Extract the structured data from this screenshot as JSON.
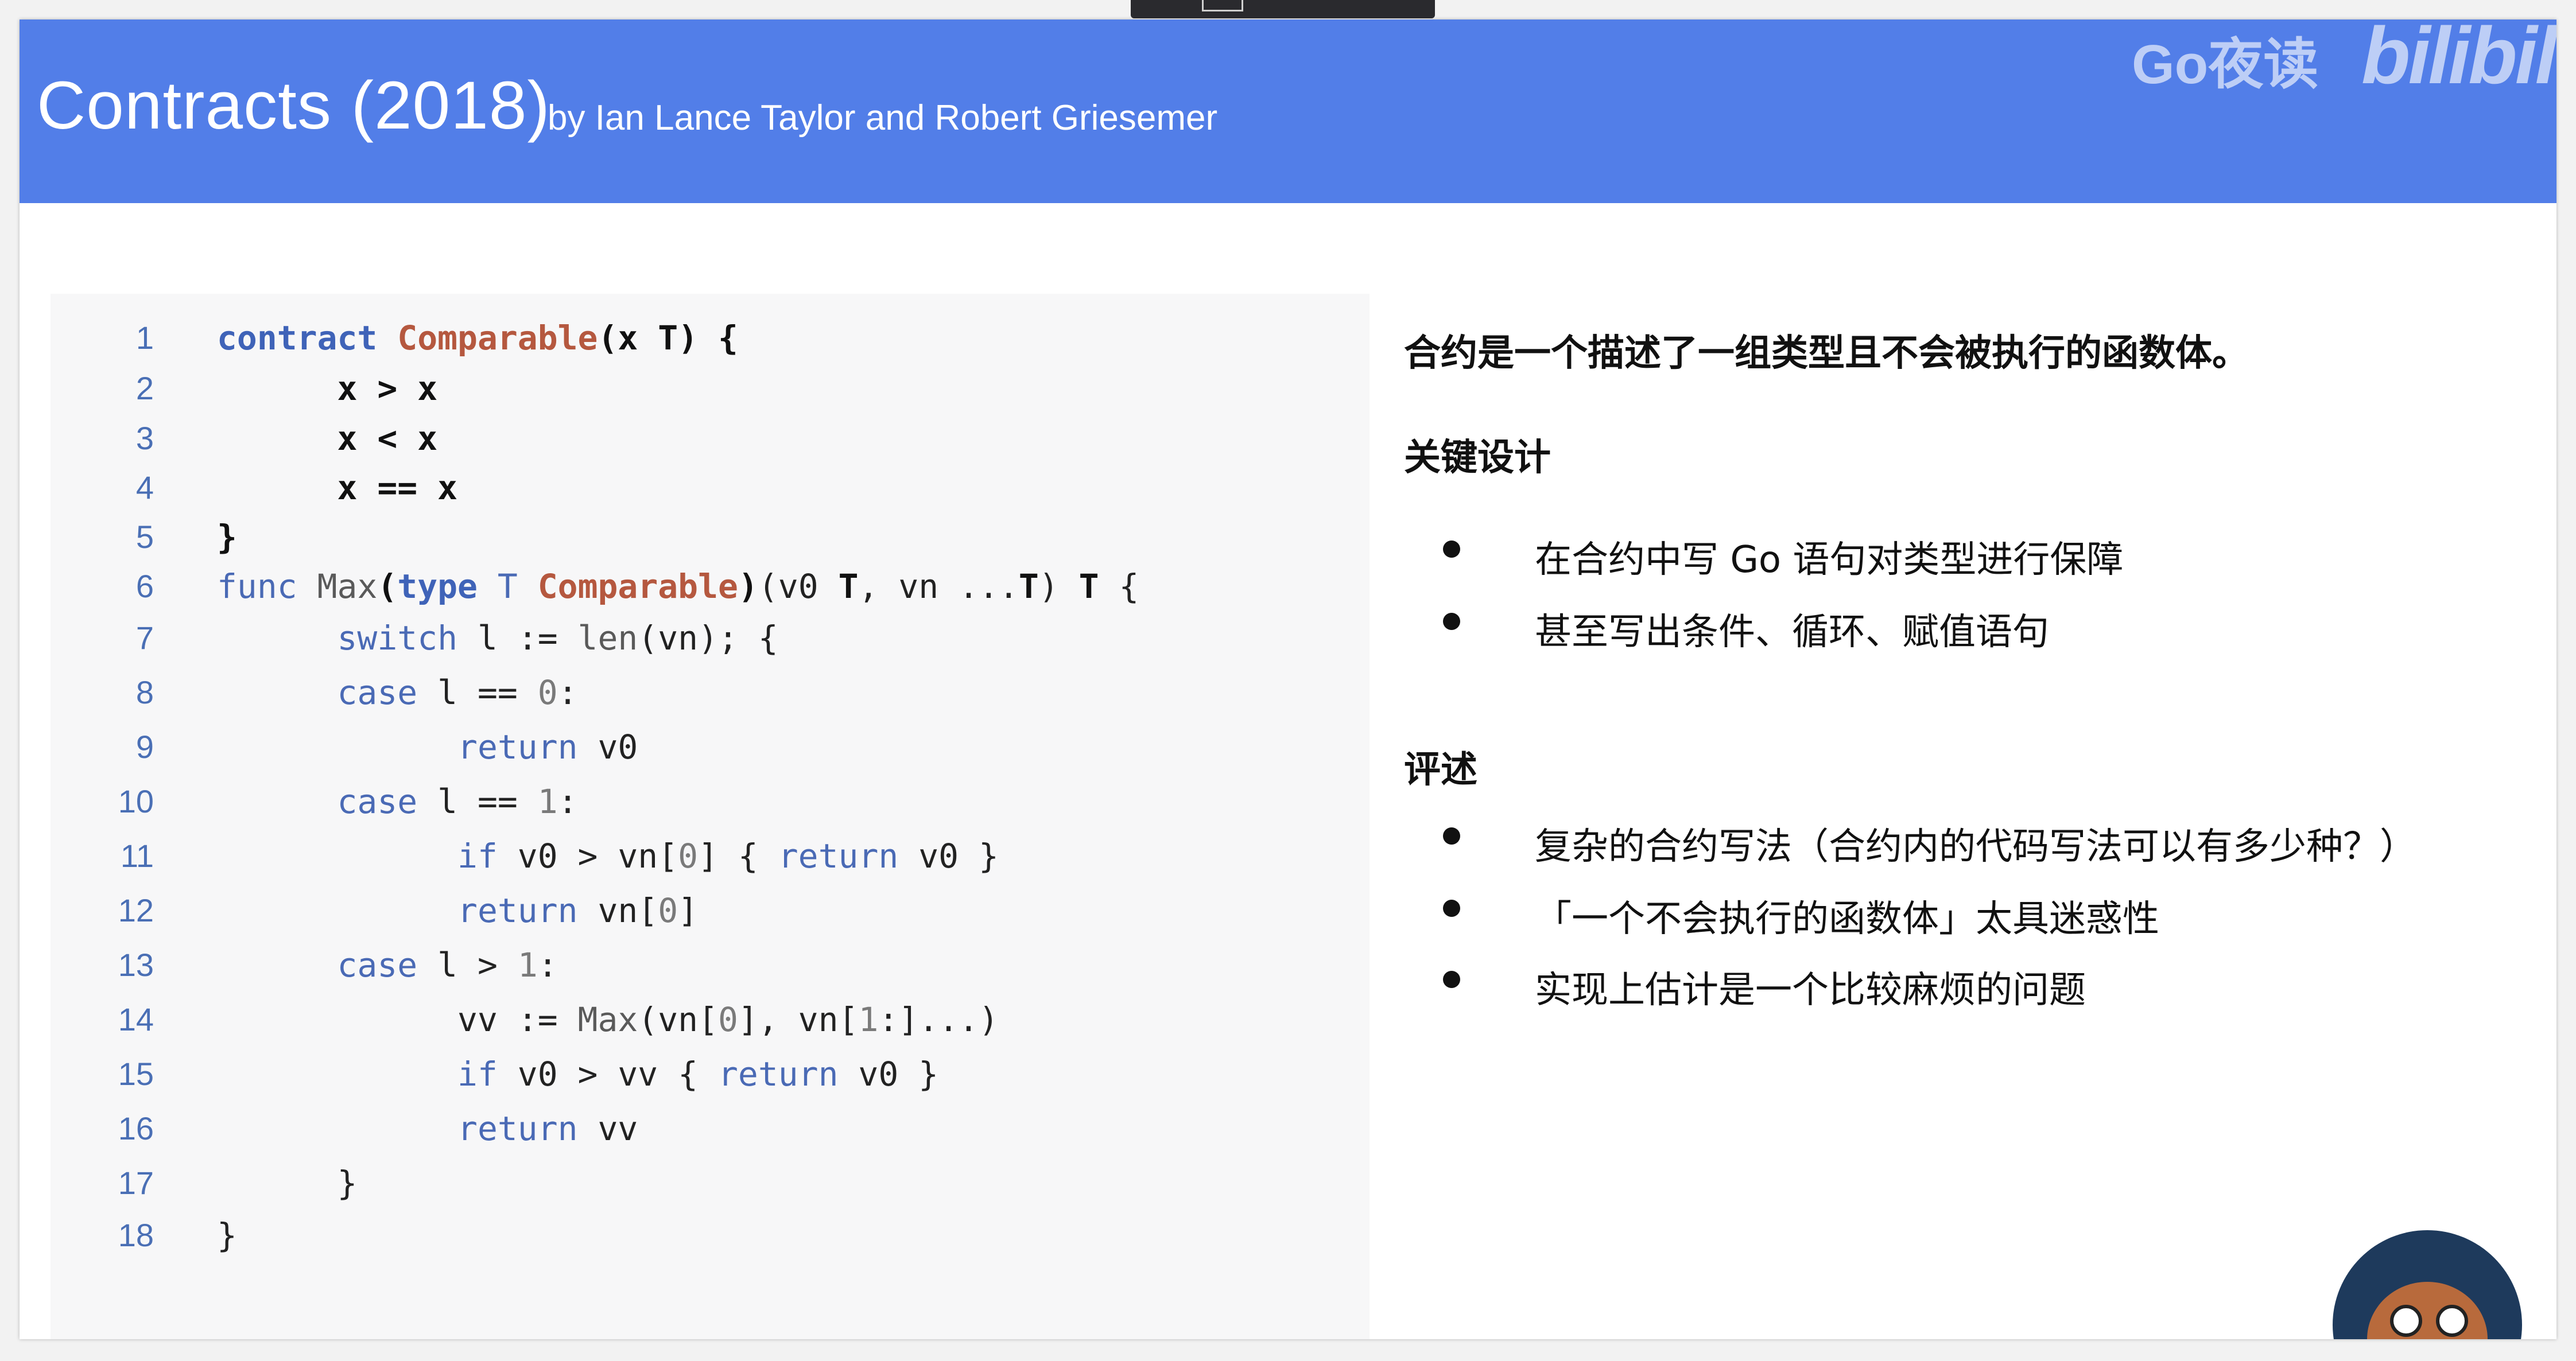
{
  "header": {
    "title": "Contracts (2018)",
    "subtitle": "by Ian Lance Taylor and Robert Griesemer",
    "watermark_text": "Go夜读",
    "watermark_logo": "bilibili",
    "background_color": "#527ee8"
  },
  "code": {
    "lines": [
      {
        "num": "1",
        "tokens": [
          {
            "t": "contract",
            "c": "kw"
          },
          {
            "t": " ",
            "c": "plain"
          },
          {
            "t": "Comparable",
            "c": "ty"
          },
          {
            "t": "(x T) {",
            "c": "bold"
          }
        ]
      },
      {
        "num": "2",
        "tokens": [
          {
            "t": "      x > x",
            "c": "bold"
          }
        ]
      },
      {
        "num": "3",
        "tokens": [
          {
            "t": "      x < x",
            "c": "bold"
          }
        ]
      },
      {
        "num": "4",
        "tokens": [
          {
            "t": "      x == x",
            "c": "bold"
          }
        ]
      },
      {
        "num": "5",
        "tokens": [
          {
            "t": "}",
            "c": "bold"
          }
        ]
      },
      {
        "num": "6",
        "tokens": [
          {
            "t": "func",
            "c": "kw2"
          },
          {
            "t": " ",
            "c": "plain"
          },
          {
            "t": "Max",
            "c": "fn"
          },
          {
            "t": "(",
            "c": "bold"
          },
          {
            "t": "type",
            "c": "kw"
          },
          {
            "t": " ",
            "c": "plain"
          },
          {
            "t": "T",
            "c": "kw2"
          },
          {
            "t": " ",
            "c": "plain"
          },
          {
            "t": "Comparable",
            "c": "ty"
          },
          {
            "t": ")",
            "c": "bold"
          },
          {
            "t": "(v0 ",
            "c": "plain"
          },
          {
            "t": "T",
            "c": "bold"
          },
          {
            "t": ", vn ...",
            "c": "plain"
          },
          {
            "t": "T",
            "c": "bold"
          },
          {
            "t": ") ",
            "c": "plain"
          },
          {
            "t": "T",
            "c": "bold"
          },
          {
            "t": " {",
            "c": "plain"
          }
        ]
      },
      {
        "num": "7",
        "tokens": [
          {
            "t": "      ",
            "c": "plain"
          },
          {
            "t": "switch",
            "c": "kw2"
          },
          {
            "t": " l := ",
            "c": "plain"
          },
          {
            "t": "len",
            "c": "fn"
          },
          {
            "t": "(vn); {",
            "c": "plain"
          }
        ]
      },
      {
        "num": "8",
        "tokens": [
          {
            "t": "      ",
            "c": "plain"
          },
          {
            "t": "case",
            "c": "kw2"
          },
          {
            "t": " l == ",
            "c": "plain"
          },
          {
            "t": "0",
            "c": "num"
          },
          {
            "t": ":",
            "c": "plain"
          }
        ]
      },
      {
        "num": "9",
        "tokens": [
          {
            "t": "            ",
            "c": "plain"
          },
          {
            "t": "return",
            "c": "kw2"
          },
          {
            "t": " v0",
            "c": "plain"
          }
        ]
      },
      {
        "num": "10",
        "tokens": [
          {
            "t": "      ",
            "c": "plain"
          },
          {
            "t": "case",
            "c": "kw2"
          },
          {
            "t": " l == ",
            "c": "plain"
          },
          {
            "t": "1",
            "c": "num"
          },
          {
            "t": ":",
            "c": "plain"
          }
        ]
      },
      {
        "num": "11",
        "tokens": [
          {
            "t": "            ",
            "c": "plain"
          },
          {
            "t": "if",
            "c": "kw2"
          },
          {
            "t": " v0 > vn[",
            "c": "plain"
          },
          {
            "t": "0",
            "c": "num"
          },
          {
            "t": "] { ",
            "c": "plain"
          },
          {
            "t": "return",
            "c": "kw2"
          },
          {
            "t": " v0 }",
            "c": "plain"
          }
        ]
      },
      {
        "num": "12",
        "tokens": [
          {
            "t": "            ",
            "c": "plain"
          },
          {
            "t": "return",
            "c": "kw2"
          },
          {
            "t": " vn[",
            "c": "plain"
          },
          {
            "t": "0",
            "c": "num"
          },
          {
            "t": "]",
            "c": "plain"
          }
        ]
      },
      {
        "num": "13",
        "tokens": [
          {
            "t": "      ",
            "c": "plain"
          },
          {
            "t": "case",
            "c": "kw2"
          },
          {
            "t": " l > ",
            "c": "plain"
          },
          {
            "t": "1",
            "c": "num"
          },
          {
            "t": ":",
            "c": "plain"
          }
        ]
      },
      {
        "num": "14",
        "tokens": [
          {
            "t": "            vv := ",
            "c": "plain"
          },
          {
            "t": "Max",
            "c": "fn"
          },
          {
            "t": "(vn[",
            "c": "plain"
          },
          {
            "t": "0",
            "c": "num"
          },
          {
            "t": "], vn[",
            "c": "plain"
          },
          {
            "t": "1",
            "c": "num"
          },
          {
            "t": ":]...)",
            "c": "plain"
          }
        ]
      },
      {
        "num": "15",
        "tokens": [
          {
            "t": "            ",
            "c": "plain"
          },
          {
            "t": "if",
            "c": "kw2"
          },
          {
            "t": " v0 > vv { ",
            "c": "plain"
          },
          {
            "t": "return",
            "c": "kw2"
          },
          {
            "t": " v0 }",
            "c": "plain"
          }
        ]
      },
      {
        "num": "16",
        "tokens": [
          {
            "t": "            ",
            "c": "plain"
          },
          {
            "t": "return",
            "c": "kw2"
          },
          {
            "t": " vv",
            "c": "plain"
          }
        ]
      },
      {
        "num": "17",
        "tokens": [
          {
            "t": "      }",
            "c": "plain"
          }
        ]
      },
      {
        "num": "18",
        "tokens": [
          {
            "t": "}",
            "c": "plain"
          }
        ]
      }
    ]
  },
  "content": {
    "description": "合约是一个描述了一组类型且不会被执行的函数体。",
    "sections": [
      {
        "title": "关键设计",
        "bullets": [
          "在合约中写 Go 语句对类型进行保障",
          "甚至写出条件、循环、赋值语句"
        ]
      },
      {
        "title": "评述",
        "bullets": [
          "复杂的合约写法（合约内的代码写法可以有多少种？）",
          "「一个不会执行的函数体」太具迷惑性",
          "实现上估计是一个比较麻烦的问题"
        ]
      }
    ]
  },
  "mascot": {
    "icon": "gopher-reading-avatar-icon"
  }
}
